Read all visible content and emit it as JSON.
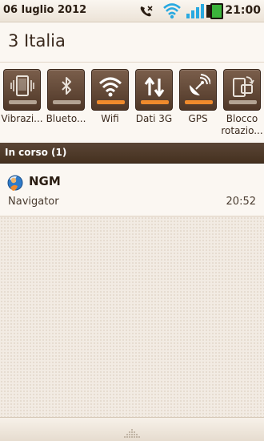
{
  "status_bar": {
    "date": "06 luglio 2012",
    "time": "21:00",
    "icons": [
      "missed-call-icon",
      "wifi-signal-icon",
      "cell-signal-icon",
      "battery-icon"
    ],
    "accent_color": "#29a9e0",
    "battery_color": "#3bb33b"
  },
  "carrier": {
    "name": "3 Italia"
  },
  "toggles": [
    {
      "label": "Vibrazi...",
      "icon": "vibrate-icon",
      "on": false
    },
    {
      "label": "Blueto...",
      "icon": "bluetooth-icon",
      "on": false
    },
    {
      "label": "Wifi",
      "icon": "wifi-icon",
      "on": true
    },
    {
      "label": "Dati 3G",
      "icon": "data-transfer-icon",
      "on": true
    },
    {
      "label": "GPS",
      "icon": "gps-satellite-icon",
      "on": true
    },
    {
      "label": "Blocco rotazio...",
      "icon": "rotation-lock-icon",
      "on": false
    }
  ],
  "toggle_colors": {
    "on": "#f08a2c",
    "off": "#b3a393"
  },
  "section": {
    "title": "In corso (1)"
  },
  "notification": {
    "title": "NGM",
    "text": "Navigator",
    "time": "20:52",
    "icon": "ngm-navigator-icon"
  }
}
